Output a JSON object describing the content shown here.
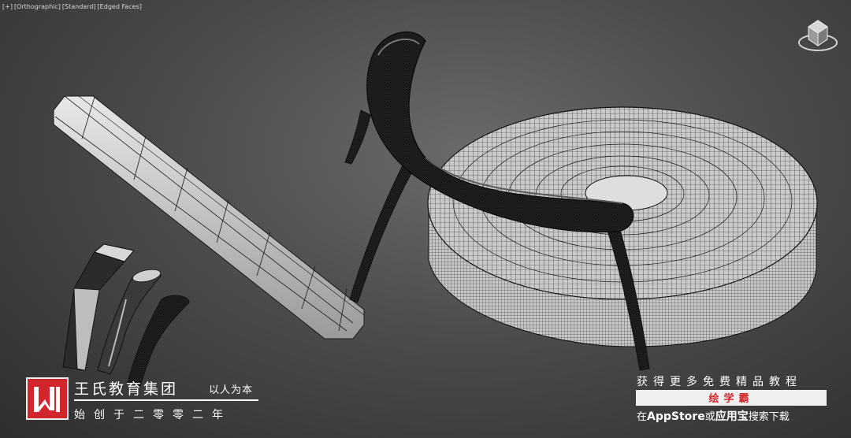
{
  "viewport": {
    "labels": [
      "[+]",
      "[Orthographic]",
      "[Standard]",
      "[Edged Faces]"
    ]
  },
  "icons": {
    "viewcube": "viewcube-icon",
    "logo": "wangshi-logo-icon"
  },
  "brand": {
    "name": "王氏教育集团",
    "slogan": "以人为本",
    "founded": "始创于二零零二年",
    "logo_letter": "W",
    "logo_color": "#d1262c"
  },
  "promo": {
    "line1": "获得更多免费精品教程",
    "app_name": "绘学霸",
    "line3_prefix": "在",
    "store1": "AppStore",
    "line3_mid": "或",
    "store2": "应用宝",
    "line3_suffix": "搜索下载",
    "accent_color": "#d4262c"
  },
  "colors": {
    "background": "#4c4c4c",
    "mesh_fill": "#d9d9d9",
    "wire": "#1a1a1a"
  }
}
